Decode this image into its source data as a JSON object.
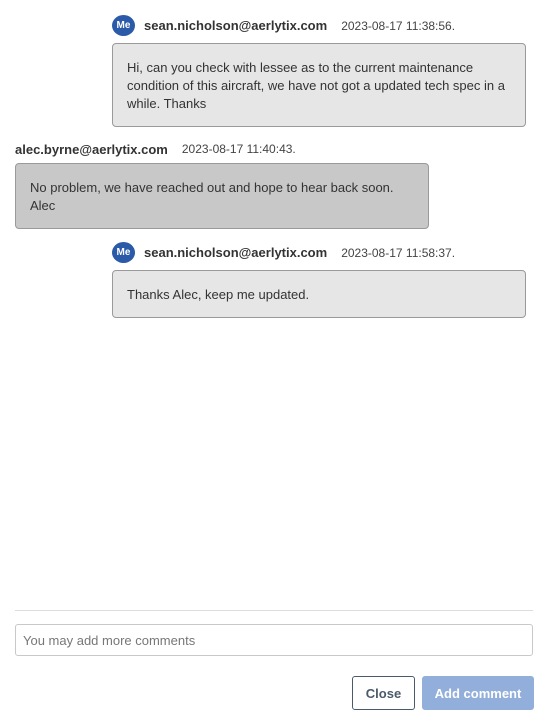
{
  "comments": [
    {
      "avatar": "Me",
      "author": "sean.nicholson@aerlytix.com",
      "timestamp": "2023-08-17 11:38:56.",
      "lines": [
        "Hi, can you check with lessee as to the current maintenance",
        "condition of this aircraft, we have not got a updated tech spec in a",
        "while. Thanks"
      ]
    },
    {
      "author": "alec.byrne@aerlytix.com",
      "timestamp": "2023-08-17 11:40:43.",
      "lines": [
        "No problem, we have reached out and hope to hear back soon.",
        "Alec"
      ]
    },
    {
      "avatar": "Me",
      "author": "sean.nicholson@aerlytix.com",
      "timestamp": "2023-08-17 11:58:37.",
      "lines": [
        "Thanks Alec, keep me updated."
      ]
    }
  ],
  "input": {
    "placeholder": "You may add more comments"
  },
  "buttons": {
    "close": "Close",
    "add_comment": "Add comment"
  },
  "colors": {
    "avatar_bg": "#2a5aa8",
    "own_bubble_bg": "#e6e6e6",
    "other_bubble_bg": "#c8c8c8",
    "add_button_bg": "#92aedb"
  }
}
